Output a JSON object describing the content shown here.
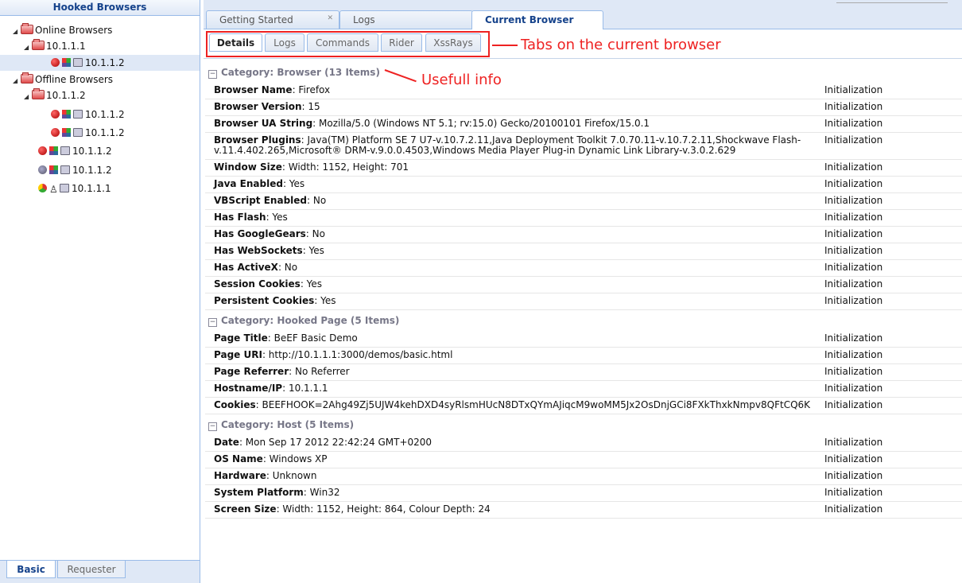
{
  "left_panel": {
    "header": "Hooked Browsers",
    "online": {
      "label": "Online Browsers",
      "group": "10.1.1.1",
      "browsers": [
        {
          "label": "10.1.1.2",
          "browser_icon": "firefox-icon",
          "os_icon": "windows-icon",
          "device_icon": "computer-icon"
        }
      ]
    },
    "offline": {
      "label": "Offline Browsers",
      "group": "10.1.1.2",
      "group_browsers": [
        {
          "label": "10.1.1.2",
          "browser_icon": "firefox-icon",
          "os_icon": "windows-icon",
          "device_icon": "computer-icon"
        },
        {
          "label": "10.1.1.2",
          "browser_icon": "firefox-icon",
          "os_icon": "windows-icon",
          "device_icon": "computer-icon"
        }
      ],
      "browsers": [
        {
          "label": "10.1.1.2",
          "browser_icon": "firefox-icon",
          "os_icon": "windows-icon",
          "device_icon": "computer-icon"
        },
        {
          "label": "10.1.1.2",
          "browser_icon": "ie-icon",
          "os_icon": "windows-icon",
          "device_icon": "computer-icon"
        },
        {
          "label": "10.1.1.1",
          "browser_icon": "chrome-icon",
          "os_icon": "linux-icon",
          "device_icon": "computer-icon"
        }
      ]
    },
    "bottom_tabs": [
      "Basic",
      "Requester"
    ]
  },
  "top_tabs": [
    "Getting Started",
    "Logs",
    "Current Browser"
  ],
  "sub_tabs": [
    "Details",
    "Logs",
    "Commands",
    "Rider",
    "XssRays"
  ],
  "annotations": {
    "tabs_note": "Tabs on the current browser",
    "info_note": "Usefull info",
    "color": "#ee2222"
  },
  "categories": [
    {
      "title": "Category: Browser (13 Items)",
      "rows": [
        {
          "key": "Browser Name",
          "value": ": Firefox",
          "source": "Initialization"
        },
        {
          "key": "Browser Version",
          "value": ": 15",
          "source": "Initialization"
        },
        {
          "key": "Browser UA String",
          "value": ": Mozilla/5.0 (Windows NT 5.1; rv:15.0) Gecko/20100101 Firefox/15.0.1",
          "source": "Initialization"
        },
        {
          "key": "Browser Plugins",
          "value": ": Java(TM) Platform SE 7 U7-v.10.7.2.11,Java Deployment Toolkit 7.0.70.11-v.10.7.2.11,Shockwave Flash-v.11.4.402.265,Microsoft® DRM-v.9.0.0.4503,Windows Media Player Plug-in Dynamic Link Library-v.3.0.2.629",
          "source": "Initialization"
        },
        {
          "key": "Window Size",
          "value": ": Width: 1152, Height: 701",
          "source": "Initialization"
        },
        {
          "key": "Java Enabled",
          "value": ": Yes",
          "source": "Initialization"
        },
        {
          "key": "VBScript Enabled",
          "value": ": No",
          "source": "Initialization"
        },
        {
          "key": "Has Flash",
          "value": ": Yes",
          "source": "Initialization"
        },
        {
          "key": "Has GoogleGears",
          "value": ": No",
          "source": "Initialization"
        },
        {
          "key": "Has WebSockets",
          "value": ": Yes",
          "source": "Initialization"
        },
        {
          "key": "Has ActiveX",
          "value": ": No",
          "source": "Initialization"
        },
        {
          "key": "Session Cookies",
          "value": ": Yes",
          "source": "Initialization"
        },
        {
          "key": "Persistent Cookies",
          "value": ": Yes",
          "source": "Initialization"
        }
      ]
    },
    {
      "title": "Category: Hooked Page (5 Items)",
      "rows": [
        {
          "key": "Page Title",
          "value": ": BeEF Basic Demo",
          "source": "Initialization"
        },
        {
          "key": "Page URI",
          "value": ": http://10.1.1.1:3000/demos/basic.html",
          "source": "Initialization"
        },
        {
          "key": "Page Referrer",
          "value": ": No Referrer",
          "source": "Initialization"
        },
        {
          "key": "Hostname/IP",
          "value": ": 10.1.1.1",
          "source": "Initialization"
        },
        {
          "key": "Cookies",
          "value": ":  BEEFHOOK=2Ahg49Zj5UJW4kehDXD4syRlsmHUcN8DTxQYmAJiqcM9woMM5Jx2OsDnjGCi8FXkThxkNmpv8QFtCQ6K",
          "source": "Initialization"
        }
      ]
    },
    {
      "title": "Category: Host (5 Items)",
      "rows": [
        {
          "key": "Date",
          "value": ": Mon Sep 17 2012 22:42:24 GMT+0200",
          "source": "Initialization"
        },
        {
          "key": "OS Name",
          "value": ": Windows XP",
          "source": "Initialization"
        },
        {
          "key": "Hardware",
          "value": ": Unknown",
          "source": "Initialization"
        },
        {
          "key": "System Platform",
          "value": ": Win32",
          "source": "Initialization"
        },
        {
          "key": "Screen Size",
          "value": ": Width: 1152, Height: 864, Colour Depth: 24",
          "source": "Initialization"
        }
      ]
    }
  ]
}
